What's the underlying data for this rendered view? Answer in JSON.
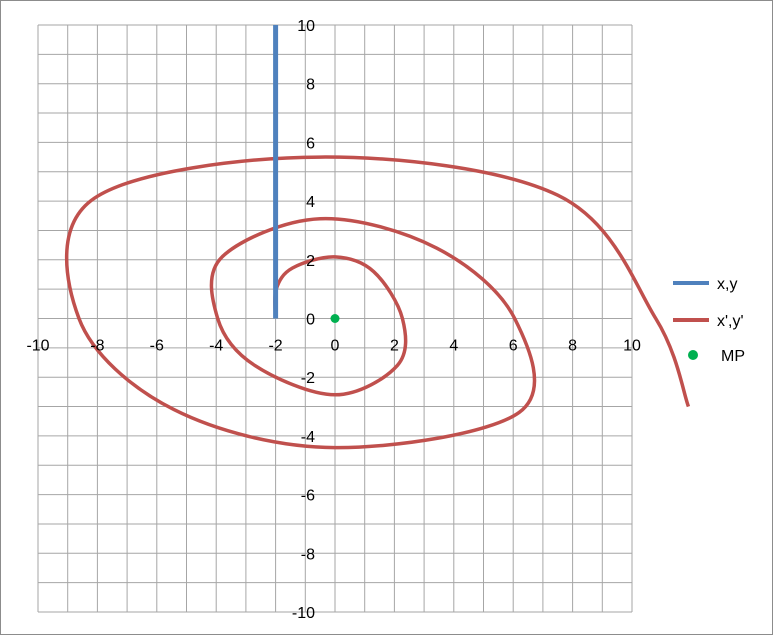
{
  "chart_data": {
    "type": "scatter",
    "title": "",
    "xlabel": "",
    "ylabel": "",
    "xlim": [
      -10,
      10
    ],
    "ylim": [
      -10,
      10
    ],
    "x_ticks": [
      -10,
      -8,
      -6,
      -4,
      -2,
      0,
      2,
      4,
      6,
      8,
      10
    ],
    "y_ticks": [
      -10,
      -8,
      -6,
      -4,
      -2,
      0,
      2,
      4,
      6,
      8,
      10
    ],
    "x_tick_labels": [
      "-10",
      "-8",
      "-6",
      "-4",
      "-2",
      "0",
      "2",
      "4",
      "6",
      "8",
      "10"
    ],
    "y_tick_labels": [
      "-10",
      "-8",
      "-6",
      "-4",
      "-2",
      "2",
      "4",
      "6",
      "8",
      "10"
    ],
    "y_zero_label": "0",
    "grid": true,
    "legend_position": "right",
    "series": [
      {
        "name": "x,y",
        "color": "#4F81BD",
        "kind": "line",
        "x": [
          -2,
          -2
        ],
        "y": [
          0,
          10
        ]
      },
      {
        "name": "x',y'",
        "color": "#C0504D",
        "kind": "line",
        "x": [
          -2,
          -1.98,
          -1.43,
          0,
          1.3,
          2.27,
          2.1,
          0,
          -2.7,
          -3.95,
          -3.8,
          -0.5,
          3.42,
          6.05,
          6.2,
          0,
          -5.43,
          -8.62,
          -8.1,
          -0.5,
          7.5,
          10.8,
          11.9
        ],
        "y": [
          0,
          1.0,
          1.72,
          2.1,
          1.6,
          0,
          -1.6,
          -2.6,
          -1.6,
          0,
          2.1,
          3.4,
          2.4,
          0,
          -3.2,
          -4.4,
          -3.1,
          0,
          4.1,
          5.5,
          4.2,
          0,
          -3.0
        ]
      },
      {
        "name": "MP",
        "color": "#00B050",
        "kind": "marker",
        "x": [
          0
        ],
        "y": [
          0
        ]
      }
    ]
  }
}
